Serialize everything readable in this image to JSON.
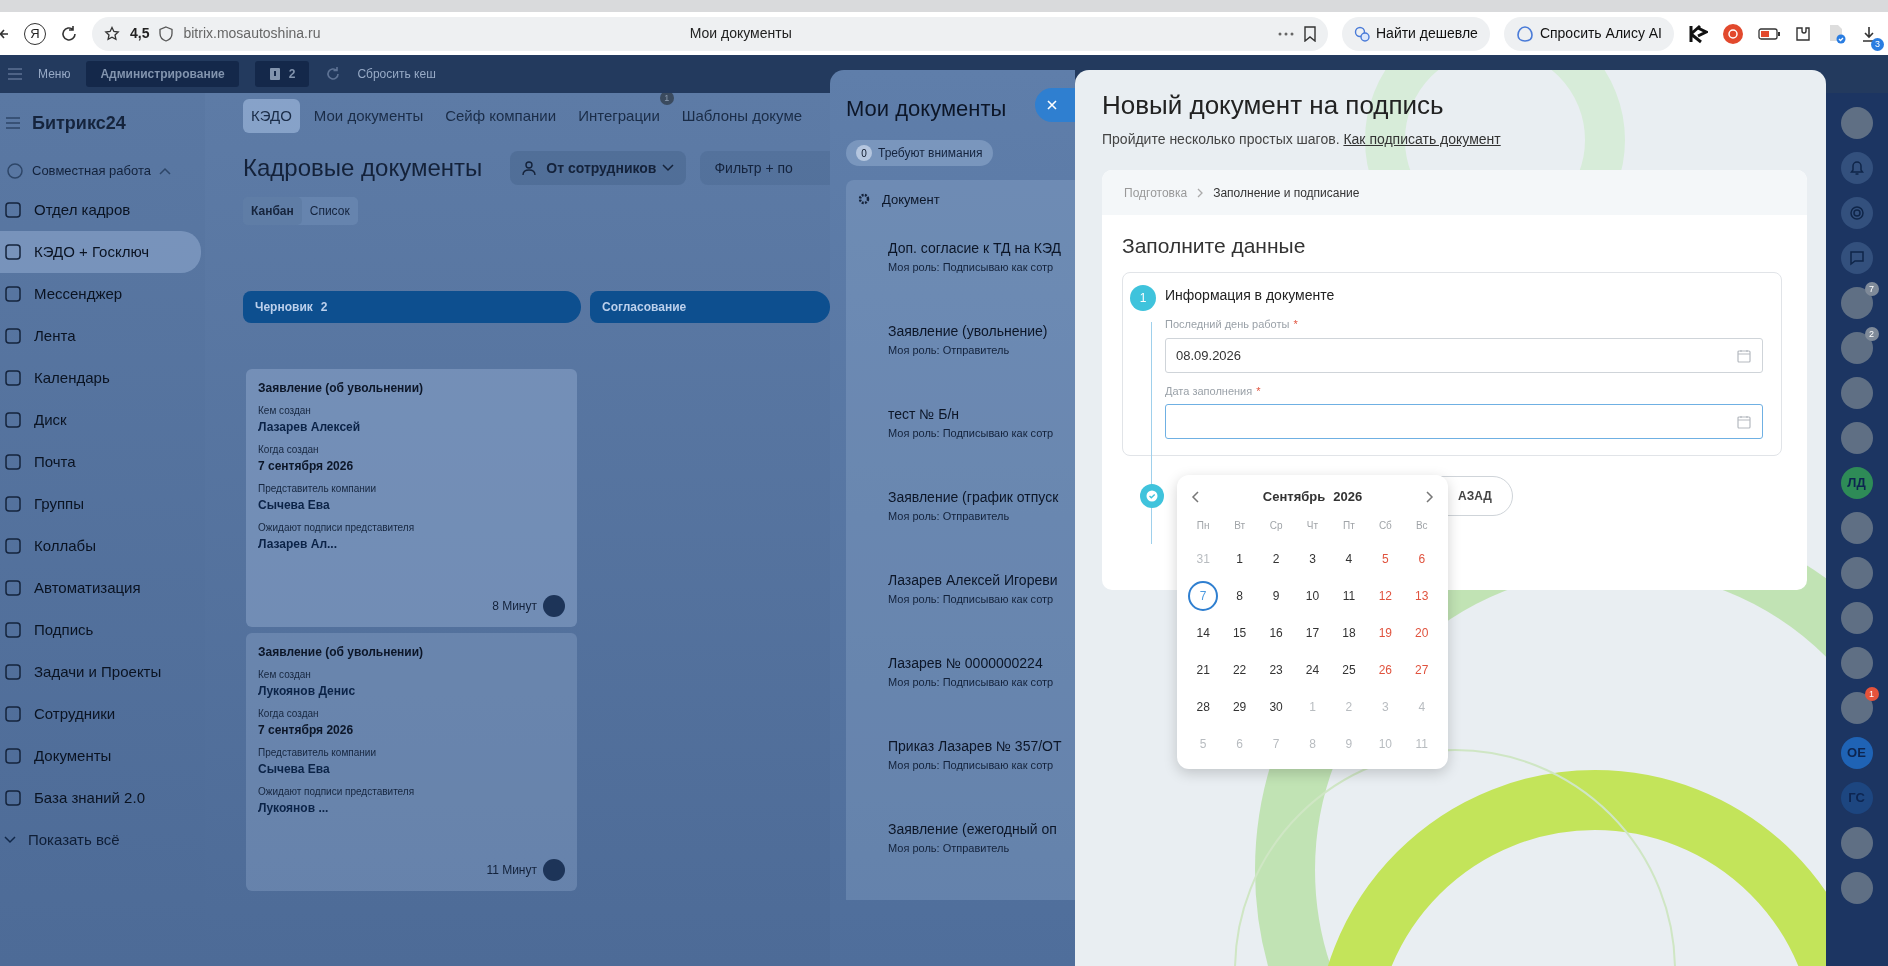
{
  "browser": {
    "logo": "Я",
    "rating": "4,5",
    "url": "bitrix.mosautoshina.ru",
    "page_title": "Мои документы",
    "buttons": [
      "Найти дешевле",
      "Спросить Алису AI"
    ],
    "download_badge": "3"
  },
  "topbar": {
    "menu": "Меню",
    "admin": "Администрирование",
    "notes_count": "2",
    "reset_cache": "Сбросить кеш"
  },
  "sidebar": {
    "logo": "Битрикс24",
    "section": "Совместная работа",
    "items": [
      {
        "label": "Отдел кадров",
        "selected": false
      },
      {
        "label": "КЭДО + Госключ",
        "selected": true
      },
      {
        "label": "Мессенджер",
        "selected": false
      },
      {
        "label": "Лента",
        "selected": false
      },
      {
        "label": "Календарь",
        "selected": false
      },
      {
        "label": "Диск",
        "selected": false
      },
      {
        "label": "Почта",
        "selected": false
      },
      {
        "label": "Группы",
        "selected": false
      },
      {
        "label": "Коллабы",
        "selected": false
      },
      {
        "label": "Автоматизация",
        "selected": false
      },
      {
        "label": "Подпись",
        "selected": false
      },
      {
        "label": "Задачи и Проекты",
        "selected": false
      },
      {
        "label": "Сотрудники",
        "selected": false
      },
      {
        "label": "Документы",
        "selected": false
      },
      {
        "label": "База знаний 2.0",
        "selected": false
      }
    ],
    "show_all": "Показать всё"
  },
  "nav": {
    "tabs": [
      {
        "label": "КЭДО",
        "selected": true
      },
      {
        "label": "Мои документы",
        "selected": false
      },
      {
        "label": "Сейф компании",
        "selected": false
      },
      {
        "label": "Интеграции",
        "selected": false,
        "badge": "1"
      },
      {
        "label": "Шаблоны докуме",
        "selected": false
      }
    ]
  },
  "page": {
    "title": "Кадровые документы",
    "filter_button": "От сотрудников",
    "search_placeholder": "Фильтр + по",
    "views": [
      {
        "label": "Канбан",
        "selected": true
      },
      {
        "label": "Список",
        "selected": false
      }
    ]
  },
  "kanban": {
    "columns": [
      {
        "title": "Черновик",
        "count": "2",
        "cards": [
          {
            "title": "Заявление (об увольнении)",
            "fields": [
              {
                "label": "Кем создан",
                "value": "Лазарев Алексей",
                "kind": "link"
              },
              {
                "label": "Когда создан",
                "value": "7 сентября 2026",
                "kind": "text"
              },
              {
                "label": "Представитель компании",
                "value": "Сычева Ева",
                "kind": "link"
              },
              {
                "label": "Ожидают подписи представителя",
                "value": "Лазарев Ал...",
                "kind": "link"
              }
            ],
            "time": "8 Минут"
          },
          {
            "title": "Заявление (об увольнении)",
            "fields": [
              {
                "label": "Кем создан",
                "value": "Лукоянов Денис",
                "kind": "link"
              },
              {
                "label": "Когда создан",
                "value": "7 сентября 2026",
                "kind": "text"
              },
              {
                "label": "Представитель компании",
                "value": "Сычева Ева",
                "kind": "link"
              },
              {
                "label": "Ожидают подписи представителя",
                "value": "Лукоянов ...",
                "kind": "link"
              }
            ],
            "time": "11 Минут"
          }
        ]
      },
      {
        "title": "Согласование"
      }
    ]
  },
  "my_documents": {
    "title": "Мои документы",
    "attention_count": "0",
    "attention_label": "Требуют внимания",
    "column": "Документ",
    "rows": [
      {
        "title": "Доп. согласие к ТД на КЭД",
        "role": "Моя роль: Подписываю как сотр"
      },
      {
        "title": "Заявление (увольнение)",
        "role": "Моя роль: Отправитель"
      },
      {
        "title": "тест № Б/н",
        "role": "Моя роль: Подписываю как сотр"
      },
      {
        "title": "Заявление (график отпуск",
        "role": "Моя роль: Отправитель"
      },
      {
        "title": "Лазарев Алексей Игореви",
        "role": "Моя роль: Подписываю как сотр"
      },
      {
        "title": "Лазарев № 0000000224",
        "role": "Моя роль: Подписываю как сотр"
      },
      {
        "title": "Приказ Лазарев № 357/ОТ",
        "role": "Моя роль: Подписываю как сотр"
      },
      {
        "title": "Заявление (ежегодный оп",
        "role": "Моя роль: Отправитель"
      }
    ]
  },
  "modal": {
    "title": "Новый документ на подпись",
    "subtitle": "Пройдите несколько простых шагов.",
    "help_link": "Как подписать документ",
    "breadcrumbs": [
      {
        "label": "Подготовка",
        "selected": false
      },
      {
        "label": "Заполнение и подписание",
        "selected": true
      }
    ],
    "heading": "Заполните данные",
    "step": {
      "number": "1",
      "title": "Информация в документе",
      "fields": [
        {
          "label": "Последний день работы",
          "required_mark": "*",
          "value": "08.09.2026",
          "focused": false
        },
        {
          "label": "Дата заполнения",
          "required_mark": "*",
          "focused": true
        }
      ]
    },
    "back_button": "АЗАД",
    "datepicker": {
      "month": "Сентябрь",
      "year": "2026",
      "weekdays": [
        "Пн",
        "Вт",
        "Ср",
        "Чт",
        "Пт",
        "Сб",
        "Вс"
      ],
      "days": [
        {
          "day": "31",
          "kind": "other"
        },
        {
          "day": "1",
          "kind": "weekday"
        },
        {
          "day": "2",
          "kind": "weekday"
        },
        {
          "day": "3",
          "kind": "weekday"
        },
        {
          "day": "4",
          "kind": "weekday"
        },
        {
          "day": "5",
          "kind": "weekend"
        },
        {
          "day": "6",
          "kind": "weekend"
        },
        {
          "day": "7",
          "kind": "today"
        },
        {
          "day": "8",
          "kind": "weekday"
        },
        {
          "day": "9",
          "kind": "weekday"
        },
        {
          "day": "10",
          "kind": "weekday"
        },
        {
          "day": "11",
          "kind": "weekday"
        },
        {
          "day": "12",
          "kind": "weekend"
        },
        {
          "day": "13",
          "kind": "weekend"
        },
        {
          "day": "14",
          "kind": "weekday"
        },
        {
          "day": "15",
          "kind": "weekday"
        },
        {
          "day": "16",
          "kind": "weekday"
        },
        {
          "day": "17",
          "kind": "weekday"
        },
        {
          "day": "18",
          "kind": "weekday"
        },
        {
          "day": "19",
          "kind": "weekend"
        },
        {
          "day": "20",
          "kind": "weekend"
        },
        {
          "day": "21",
          "kind": "weekday"
        },
        {
          "day": "22",
          "kind": "weekday"
        },
        {
          "day": "23",
          "kind": "weekday"
        },
        {
          "day": "24",
          "kind": "weekday"
        },
        {
          "day": "25",
          "kind": "weekday"
        },
        {
          "day": "26",
          "kind": "weekend"
        },
        {
          "day": "27",
          "kind": "weekend"
        },
        {
          "day": "28",
          "kind": "weekday"
        },
        {
          "day": "29",
          "kind": "weekday"
        },
        {
          "day": "30",
          "kind": "weekday"
        },
        {
          "day": "1",
          "kind": "other"
        },
        {
          "day": "2",
          "kind": "other"
        },
        {
          "day": "3",
          "kind": "other"
        },
        {
          "day": "4",
          "kind": "other"
        },
        {
          "day": "5",
          "kind": "other"
        },
        {
          "day": "6",
          "kind": "other"
        },
        {
          "day": "7",
          "kind": "other"
        },
        {
          "day": "8",
          "kind": "other"
        },
        {
          "day": "9",
          "kind": "other"
        },
        {
          "day": "10",
          "kind": "other"
        },
        {
          "day": "11",
          "kind": "other"
        }
      ]
    }
  },
  "rightbar": {
    "items": [
      {
        "kind": "photo"
      },
      {
        "kind": "bell"
      },
      {
        "kind": "spiral"
      },
      {
        "kind": "chat"
      },
      {
        "kind": "photo",
        "badge": "7"
      },
      {
        "kind": "photo",
        "badge": "2"
      },
      {
        "kind": "photo"
      },
      {
        "kind": "photo"
      },
      {
        "kind": "initials",
        "label": "ЛД",
        "color": "#2e8b57"
      },
      {
        "kind": "photo"
      },
      {
        "kind": "photo"
      },
      {
        "kind": "photo"
      },
      {
        "kind": "photo"
      },
      {
        "kind": "photo",
        "badge": "1"
      },
      {
        "kind": "initials",
        "label": "ОЕ",
        "color": "#1f63b5"
      },
      {
        "kind": "initials",
        "label": "ГС",
        "color": "#1d4680"
      },
      {
        "kind": "photo"
      },
      {
        "kind": "photo"
      }
    ]
  }
}
